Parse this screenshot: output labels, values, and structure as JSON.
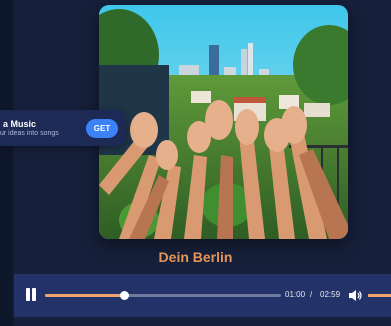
{
  "promo": {
    "title": "a Music",
    "subtitle": "ur ideas into songs",
    "cta_label": "GET"
  },
  "track": {
    "title": "Dein Berlin"
  },
  "player": {
    "state": "playing",
    "current_time": "01:00",
    "separator": "/",
    "duration": "02:59",
    "progress": 0.335,
    "volume": 1.0
  },
  "colors": {
    "background": "#16203a",
    "player_bar": "#24326a",
    "accent": "#f0a36c",
    "title": "#e6935a",
    "cta": "#3b82f6"
  },
  "icons": {
    "play_state": "pause-icon",
    "volume": "volume-icon"
  }
}
